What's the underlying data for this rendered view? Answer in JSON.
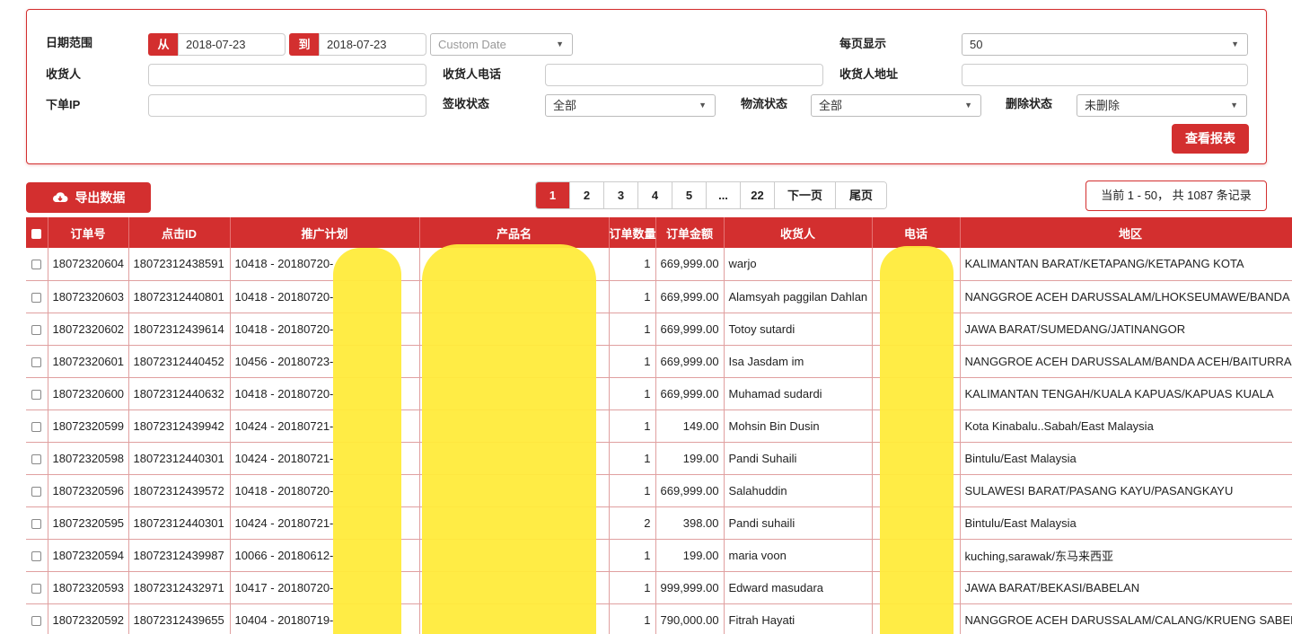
{
  "filters": {
    "date_range_label": "日期范围",
    "from_tag": "从",
    "from_value": "2018-07-23",
    "to_tag": "到",
    "to_value": "2018-07-23",
    "custom_date_placeholder": "Custom Date",
    "per_page_label": "每页显示",
    "per_page_value": "50",
    "receiver_label": "收货人",
    "receiver_phone_label": "收货人电话",
    "receiver_address_label": "收货人地址",
    "order_ip_label": "下单IP",
    "sign_status_label": "签收状态",
    "sign_status_value": "全部",
    "logistics_status_label": "物流状态",
    "logistics_status_value": "全部",
    "delete_status_label": "删除状态",
    "delete_status_value": "未删除",
    "query_button": "查看报表"
  },
  "toolbar": {
    "export_button": "导出数据"
  },
  "pagination": {
    "pages": [
      "1",
      "2",
      "3",
      "4",
      "5",
      "...",
      "22"
    ],
    "next_label": "下一页",
    "last_label": "尾页",
    "active_page": "1"
  },
  "records_summary": "当前 1 - 50， 共 1087 条记录",
  "table": {
    "columns": [
      "订单号",
      "点击ID",
      "推广计划",
      "产品名",
      "订单数量",
      "订单金额",
      "收货人",
      "电话",
      "地区"
    ],
    "rows": [
      {
        "order": "18072320604",
        "click": "18072312438591",
        "plan": "10418 - 20180720-",
        "product": "",
        "qty": "1",
        "amount": "669,999.00",
        "receiver": "warjo",
        "phone": "",
        "region": "KALIMANTAN BARAT/KETAPANG/KETAPANG KOTA"
      },
      {
        "order": "18072320603",
        "click": "18072312440801",
        "plan": "10418 - 20180720-",
        "product": "",
        "qty": "1",
        "amount": "669,999.00",
        "receiver": "Alamsyah paggilan Dahlan",
        "phone": "",
        "region": "NANGGROE ACEH DARUSSALAM/LHOKSEUMAWE/BANDA"
      },
      {
        "order": "18072320602",
        "click": "18072312439614",
        "plan": "10418 - 20180720-",
        "product": "",
        "qty": "1",
        "amount": "669,999.00",
        "receiver": "Totoy sutardi",
        "phone": "",
        "region": "JAWA BARAT/SUMEDANG/JATINANGOR"
      },
      {
        "order": "18072320601",
        "click": "18072312440452",
        "plan": "10456 - 20180723-",
        "product": "",
        "qty": "1",
        "amount": "669,999.00",
        "receiver": "Isa Jasdam im",
        "phone": "",
        "region": "NANGGROE ACEH DARUSSALAM/BANDA ACEH/BAITURRA"
      },
      {
        "order": "18072320600",
        "click": "18072312440632",
        "plan": "10418 - 20180720-",
        "product": "",
        "qty": "1",
        "amount": "669,999.00",
        "receiver": "Muhamad sudardi",
        "phone": "",
        "region": "KALIMANTAN TENGAH/KUALA KAPUAS/KAPUAS KUALA"
      },
      {
        "order": "18072320599",
        "click": "18072312439942",
        "plan": "10424 - 20180721-",
        "product": "",
        "qty": "1",
        "amount": "149.00",
        "receiver": "Mohsin Bin Dusin",
        "phone": "",
        "region": "Kota Kinabalu..Sabah/East Malaysia"
      },
      {
        "order": "18072320598",
        "click": "18072312440301",
        "plan": "10424 - 20180721-",
        "product": "",
        "qty": "1",
        "amount": "199.00",
        "receiver": "Pandi Suhaili",
        "phone": "",
        "region": "Bintulu/East Malaysia"
      },
      {
        "order": "18072320596",
        "click": "18072312439572",
        "plan": "10418 - 20180720-",
        "product": "",
        "qty": "1",
        "amount": "669,999.00",
        "receiver": "Salahuddin",
        "phone": "",
        "region": "SULAWESI BARAT/PASANG KAYU/PASANGKAYU"
      },
      {
        "order": "18072320595",
        "click": "18072312440301",
        "plan": "10424 - 20180721-",
        "product": "",
        "qty": "2",
        "amount": "398.00",
        "receiver": "Pandi suhaili",
        "phone": "",
        "region": "Bintulu/East Malaysia"
      },
      {
        "order": "18072320594",
        "click": "18072312439987",
        "plan": "10066 - 20180612-",
        "product": "",
        "qty": "1",
        "amount": "199.00",
        "receiver": "maria voon",
        "phone": "",
        "region": "kuching,sarawak/东马来西亚"
      },
      {
        "order": "18072320593",
        "click": "18072312432971",
        "plan": "10417 - 20180720-",
        "product": "",
        "qty": "1",
        "amount": "999,999.00",
        "receiver": "Edward masudara",
        "phone": "",
        "region": "JAWA BARAT/BEKASI/BABELAN"
      },
      {
        "order": "18072320592",
        "click": "18072312439655",
        "plan": "10404 - 20180719-",
        "product": "",
        "qty": "1",
        "amount": "790,000.00",
        "receiver": "Fitrah Hayati",
        "phone": "",
        "region": "NANGGROE ACEH DARUSSALAM/CALANG/KRUENG SABEE"
      }
    ]
  },
  "colors": {
    "accent": "#d32f2f",
    "redaction": "#ffeb3b"
  }
}
